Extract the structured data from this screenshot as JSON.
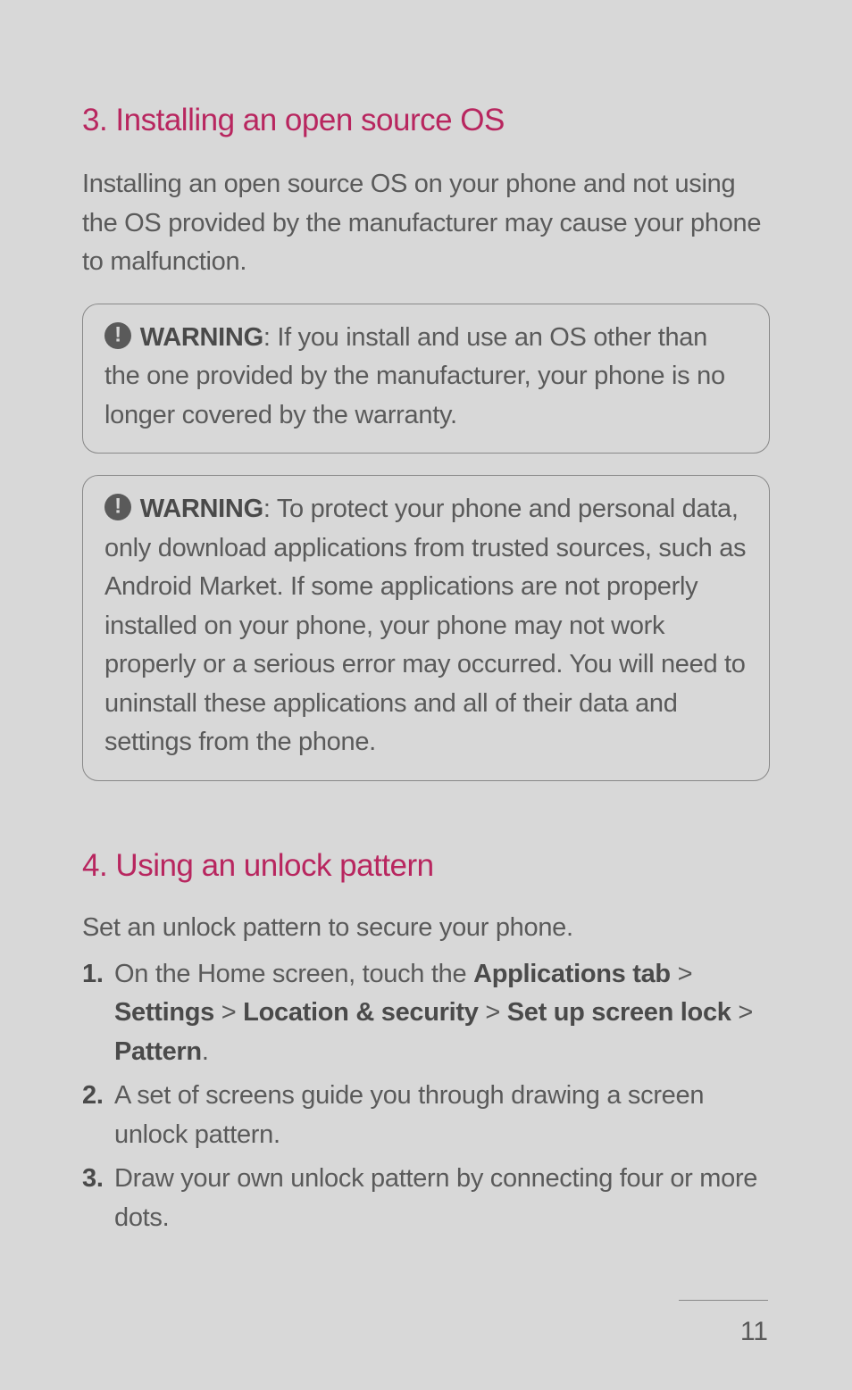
{
  "section1": {
    "heading": "3. Installing an open source OS",
    "intro": "Installing an open source OS on your phone and not using the OS provided by the manufacturer may cause your phone to malfunction."
  },
  "warning1": {
    "label": "WARNING",
    "text": ": If you install and use an OS other than the one provided by the manufacturer, your phone is no longer covered by the warranty."
  },
  "warning2": {
    "label": "WARNING",
    "text": ": To protect your phone and personal data, only download applications from trusted sources, such as Android Market.  If some applications are not properly installed on your phone, your phone may not work properly or a serious error may occurred. You will need to uninstall these applications and all of their data and settings from the phone."
  },
  "section2": {
    "heading": "4. Using an unlock pattern",
    "intro": "Set an unlock pattern to secure your phone."
  },
  "steps": {
    "step1": {
      "num": "1.",
      "pre": "On the Home screen, touch the ",
      "b1": "Applications tab",
      "s1": " > ",
      "b2": "Settings",
      "s2": " > ",
      "b3": "Location & security",
      "s3": " > ",
      "b4": "Set up screen lock",
      "s4": " > ",
      "b5": "Pattern",
      "post": "."
    },
    "step2": {
      "num": "2.",
      "text": "A set of screens guide you through drawing a screen unlock pattern."
    },
    "step3": {
      "num": "3.",
      "text": "Draw your own unlock pattern by connecting four or more dots."
    }
  },
  "pageNumber": "11"
}
